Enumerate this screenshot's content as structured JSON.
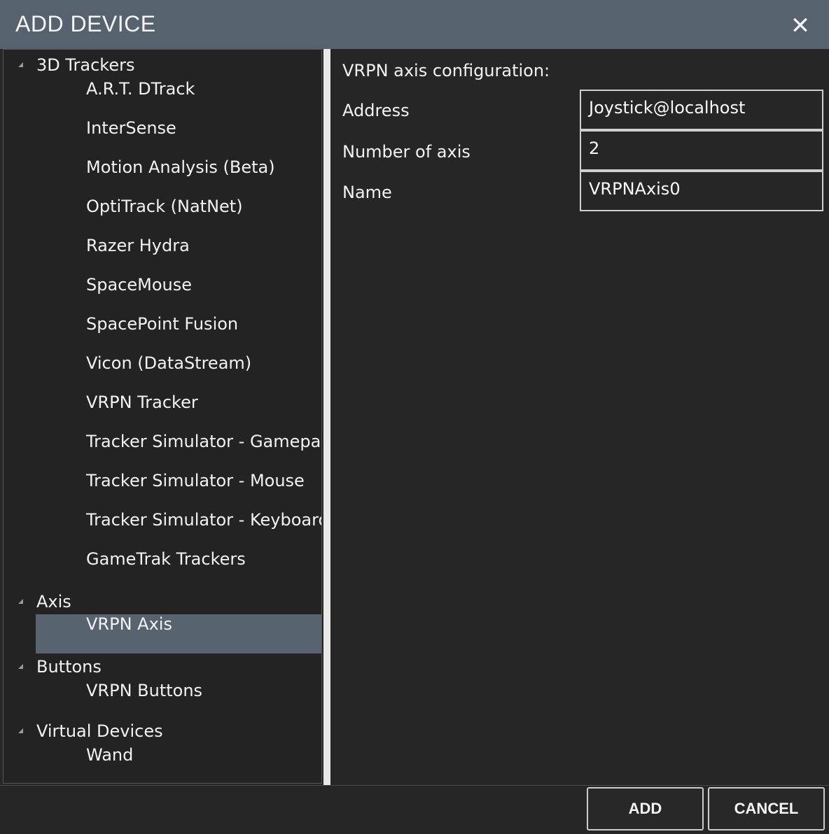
{
  "window": {
    "title": "ADD DEVICE",
    "close_glyph": "✕"
  },
  "tree": {
    "categories": [
      {
        "label": "3D Trackers",
        "items": [
          "A.R.T. DTrack",
          "InterSense",
          "Motion Analysis (Beta)",
          "OptiTrack (NatNet)",
          "Razer Hydra",
          "SpaceMouse",
          "SpacePoint Fusion",
          "Vicon (DataStream)",
          "VRPN Tracker",
          "Tracker Simulator - Gamepad",
          "Tracker Simulator - Mouse",
          "Tracker Simulator - Keyboard",
          "GameTrak Trackers"
        ]
      },
      {
        "label": "Axis",
        "items": [
          "VRPN Axis"
        ]
      },
      {
        "label": "Buttons",
        "items": [
          "VRPN Buttons"
        ]
      },
      {
        "label": "Virtual Devices",
        "items": [
          "Wand"
        ]
      }
    ],
    "selected": "VRPN Axis"
  },
  "config": {
    "title": "VRPN axis configuration:",
    "fields": [
      {
        "label": "Address",
        "value": "Joystick@localhost"
      },
      {
        "label": "Number of axis",
        "value": "2"
      },
      {
        "label": "Name",
        "value": "VRPNAxis0"
      }
    ]
  },
  "footer": {
    "add_label": "ADD",
    "cancel_label": "CANCEL"
  },
  "colors": {
    "titlebar": "#56626e",
    "selected": "#57636f",
    "background": "#262626"
  }
}
